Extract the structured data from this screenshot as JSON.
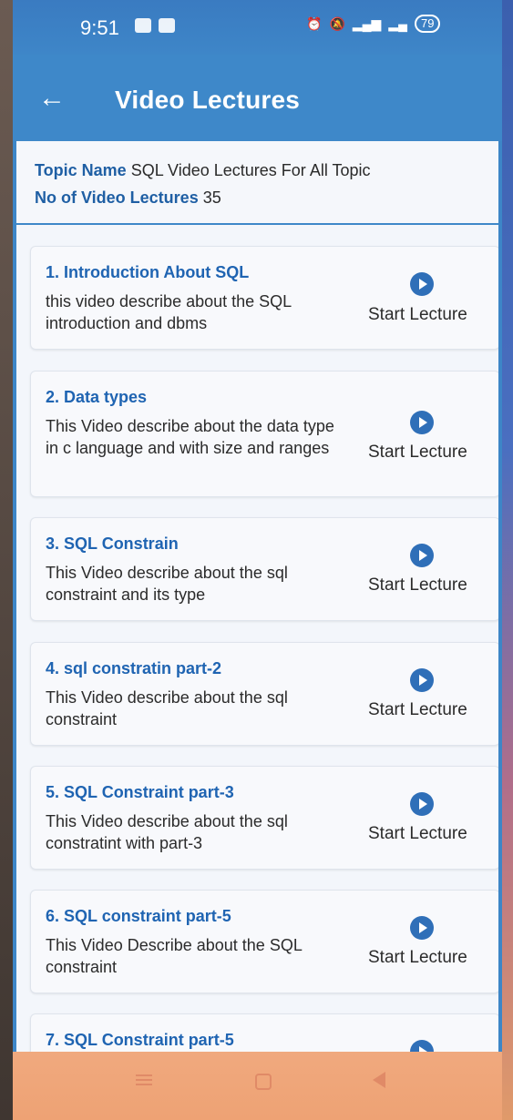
{
  "status": {
    "time": "9:51",
    "battery": "79"
  },
  "app_bar": {
    "back_icon": "arrow-left-icon",
    "title": "Video Lectures"
  },
  "topic": {
    "name_label": "Topic Name",
    "name_value": "SQL Video Lectures For All Topic",
    "count_label": "No of Video Lectures",
    "count_value": "35"
  },
  "lectures": [
    {
      "title": "1. Introduction About SQL",
      "desc": "this video describe about the SQL introduction and dbms",
      "action": "Start Lecture"
    },
    {
      "title": "2. Data types",
      "desc": "This Video describe about the data type in c language and with size and ranges",
      "action": "Start Lecture"
    },
    {
      "title": "3. SQL Constrain",
      "desc": "This Video describe about the sql constraint and its type",
      "action": "Start Lecture"
    },
    {
      "title": "4. sql constratin part-2",
      "desc": "This Video describe about the sql constraint",
      "action": "Start Lecture"
    },
    {
      "title": "5. SQL Constraint part-3",
      "desc": "This Video describe about the sql constratint with part-3",
      "action": "Start Lecture"
    },
    {
      "title": "6. SQL constraint part-5",
      "desc": "This Video Describe about the SQL constraint",
      "action": "Start Lecture"
    },
    {
      "title": "7. SQL Constraint part-5",
      "desc": "",
      "action": ""
    }
  ],
  "colors": {
    "app_bar": "#3e88c9",
    "title_blue": "#1f64b2",
    "nav_bar": "#eea274"
  }
}
